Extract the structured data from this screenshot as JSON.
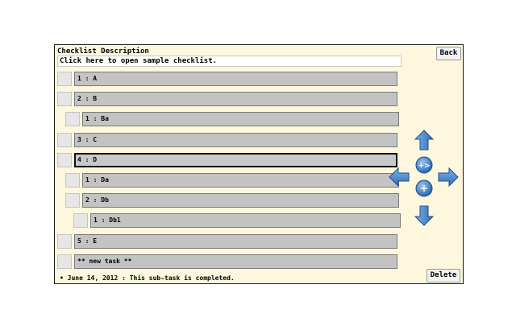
{
  "checklist": {
    "label": "Checklist Description",
    "open_text": "Click here to open sample checklist."
  },
  "buttons": {
    "back": "Back",
    "delete": "Delete"
  },
  "tasks": [
    {
      "text": "1 : A",
      "level": 0,
      "selected": false
    },
    {
      "text": "2 : B",
      "level": 0,
      "selected": false
    },
    {
      "text": "1 : Ba",
      "level": 1,
      "selected": false
    },
    {
      "text": "3 : C",
      "level": 0,
      "selected": false
    },
    {
      "text": "4 : D",
      "level": 0,
      "selected": true
    },
    {
      "text": "1 : Da",
      "level": 1,
      "selected": false
    },
    {
      "text": "2 : Db",
      "level": 1,
      "selected": false
    },
    {
      "text": "1 : Db1",
      "level": 2,
      "selected": false
    },
    {
      "text": "5 : E",
      "level": 0,
      "selected": false
    },
    {
      "text": "** new task **",
      "level": 0,
      "selected": false
    }
  ],
  "status": "• June 14, 2012 : This sub-task is completed.",
  "controls": {
    "up": "arrow-up-icon",
    "down": "arrow-down-icon",
    "left": "arrow-left-icon",
    "right": "arrow-right-icon",
    "add_subtask": "add-subtask-icon",
    "add": "add-icon"
  },
  "colors": {
    "panel_bg": "#fdf7dd",
    "task_bar": "#c3c3c3",
    "arrow_blue": "#3f7fc8"
  }
}
